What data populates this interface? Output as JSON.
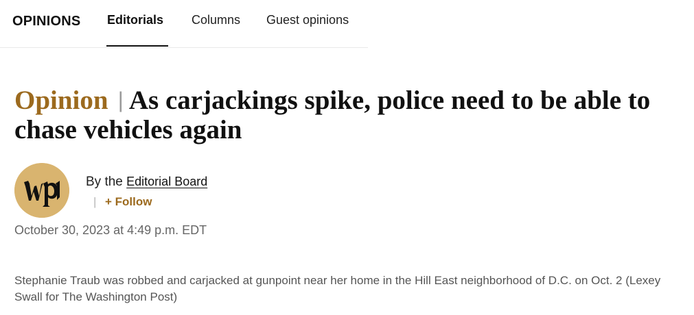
{
  "nav": {
    "section": "OPINIONS",
    "tabs": [
      {
        "label": "Editorials",
        "active": true
      },
      {
        "label": "Columns",
        "active": false
      },
      {
        "label": "Guest opinions",
        "active": false
      }
    ]
  },
  "article": {
    "kicker": "Opinion",
    "separator": "|",
    "title": "As carjackings spike, police need to be able to chase vehicles again",
    "byline": {
      "prefix": "By the",
      "author": "Editorial Board",
      "follow_separator": "|",
      "follow_label": "+ Follow"
    },
    "timestamp": "October 30, 2023 at 4:49 p.m. EDT",
    "avatar_icon": "wp-logo-icon",
    "photo_caption": "Stephanie Traub was robbed and carjacked at gunpoint near her home in the Hill East neighborhood of D.C. on Oct. 2 (Lexey Swall for The Washington Post)"
  },
  "colors": {
    "accent": "#9c6a1e",
    "avatar_bg": "#d9b46f",
    "text": "#111111",
    "muted": "#666666"
  }
}
